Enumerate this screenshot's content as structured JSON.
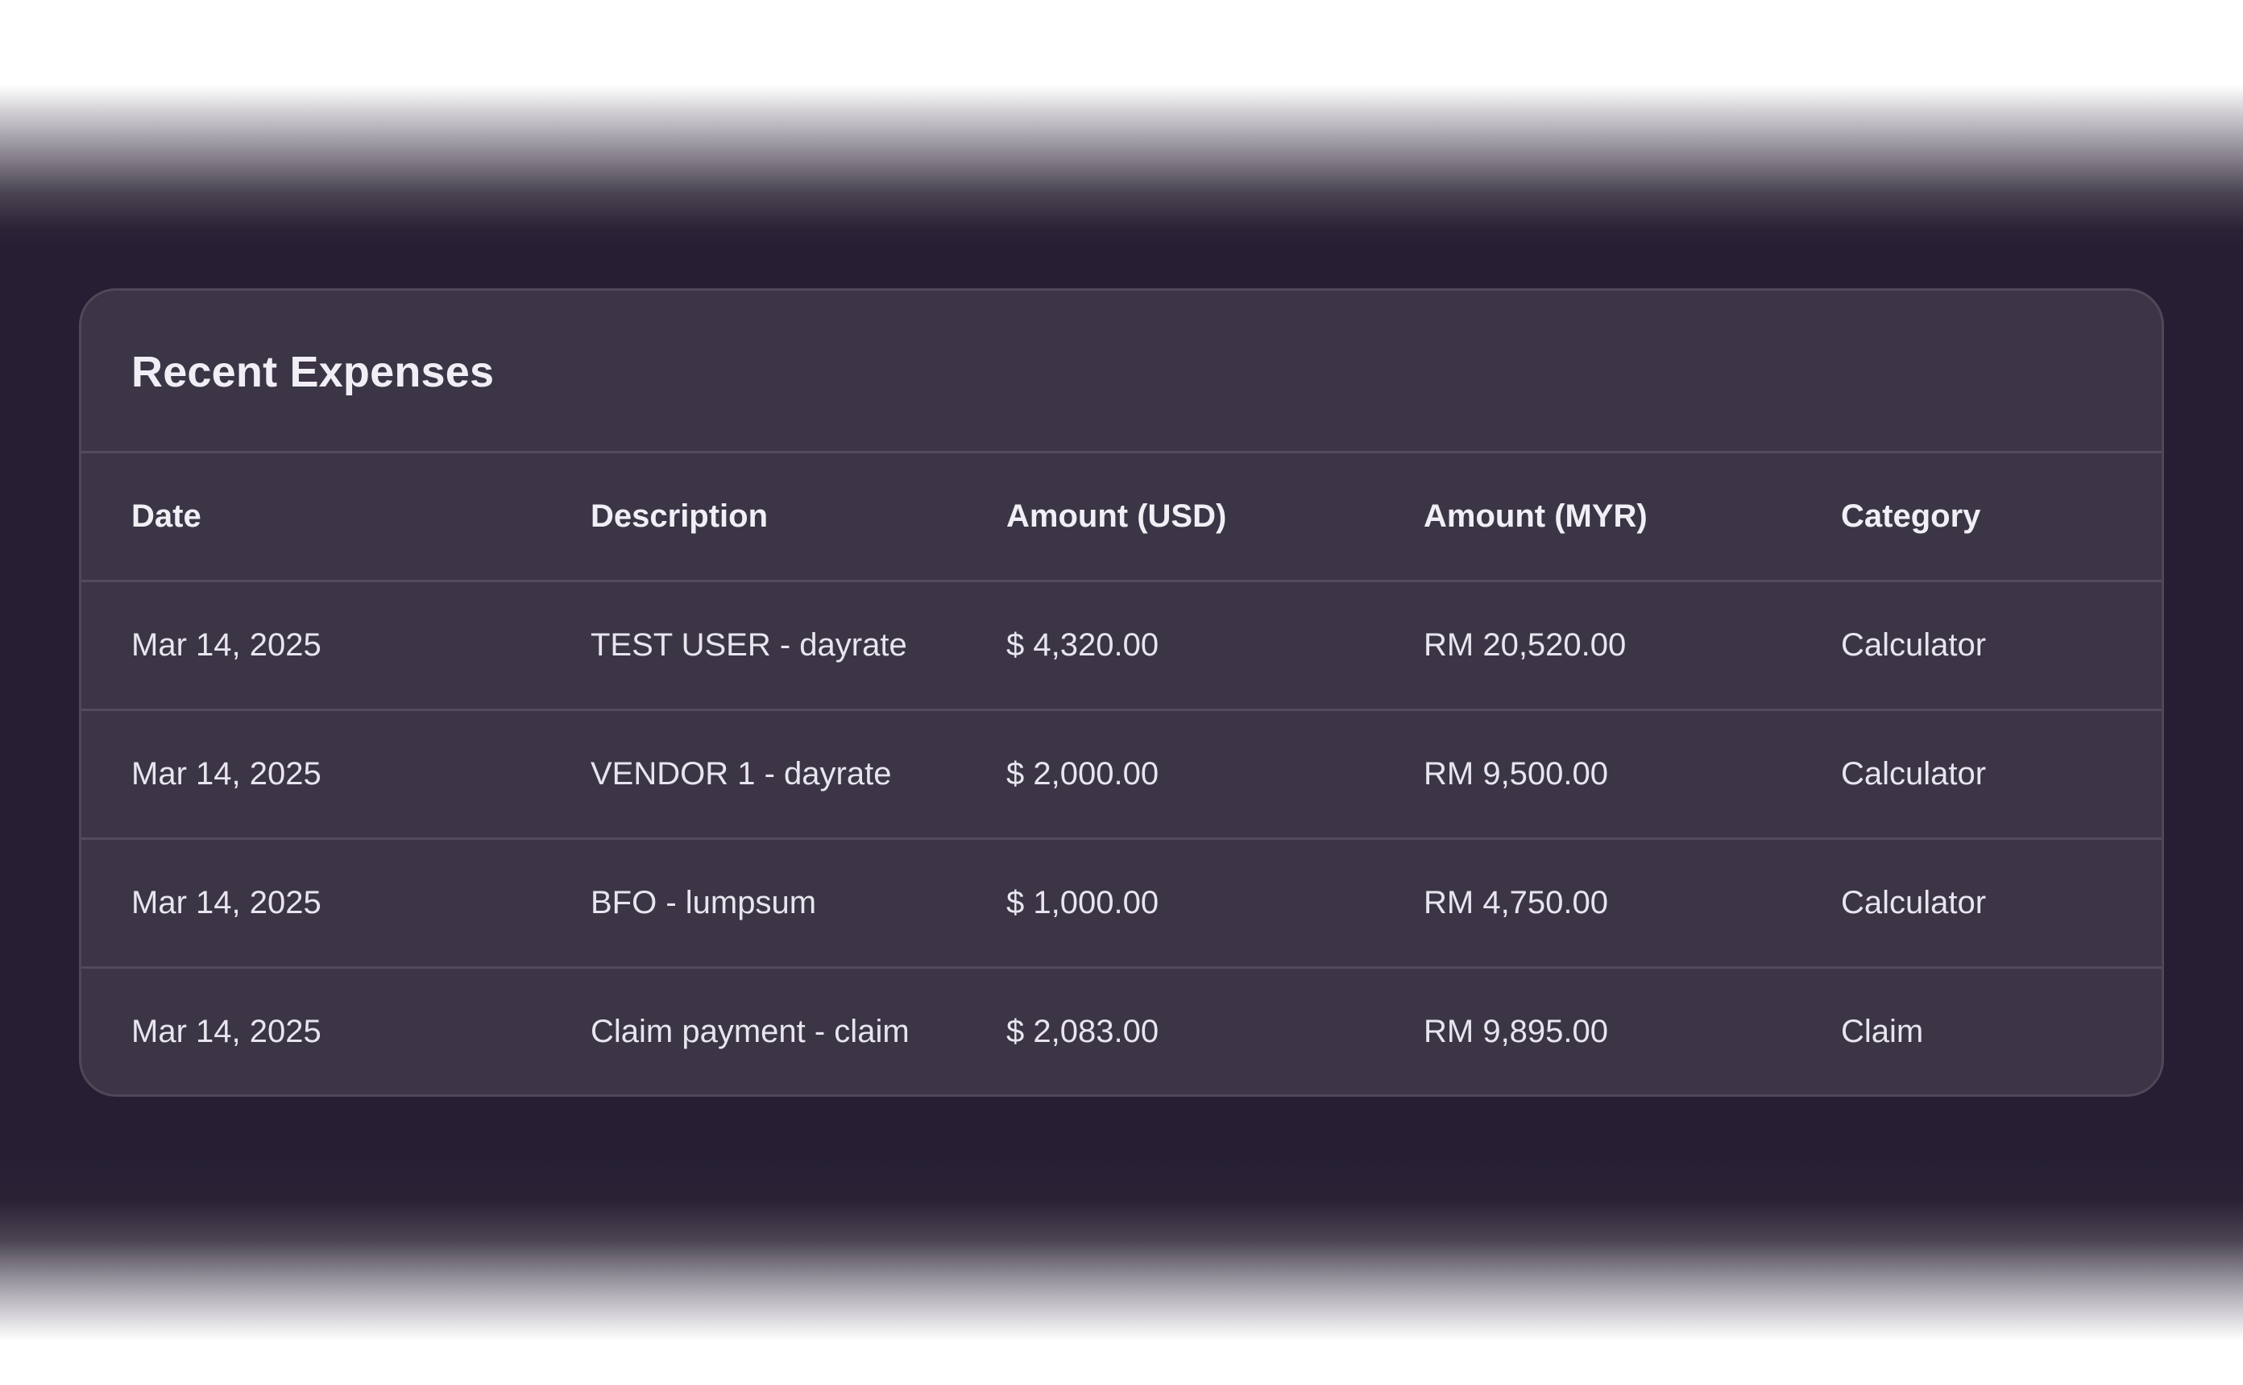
{
  "card": {
    "title": "Recent Expenses"
  },
  "table": {
    "headers": [
      "Date",
      "Description",
      "Amount (USD)",
      "Amount (MYR)",
      "Category"
    ],
    "rows": [
      [
        "Mar 14, 2025",
        "TEST USER - dayrate",
        "$ 4,320.00",
        "RM 20,520.00",
        "Calculator"
      ],
      [
        "Mar 14, 2025",
        "VENDOR 1 - dayrate",
        "$ 2,000.00",
        "RM 9,500.00",
        "Calculator"
      ],
      [
        "Mar 14, 2025",
        "BFO - lumpsum",
        "$ 1,000.00",
        "RM 4,750.00",
        "Calculator"
      ],
      [
        "Mar 14, 2025",
        "Claim payment - claim",
        "$ 2,083.00",
        "RM 9,895.00",
        "Claim"
      ]
    ]
  },
  "colors": {
    "page_background": "#261f33",
    "card_background": "#3c3546",
    "divider": "#524b5b",
    "text": "#e8e5ee"
  }
}
